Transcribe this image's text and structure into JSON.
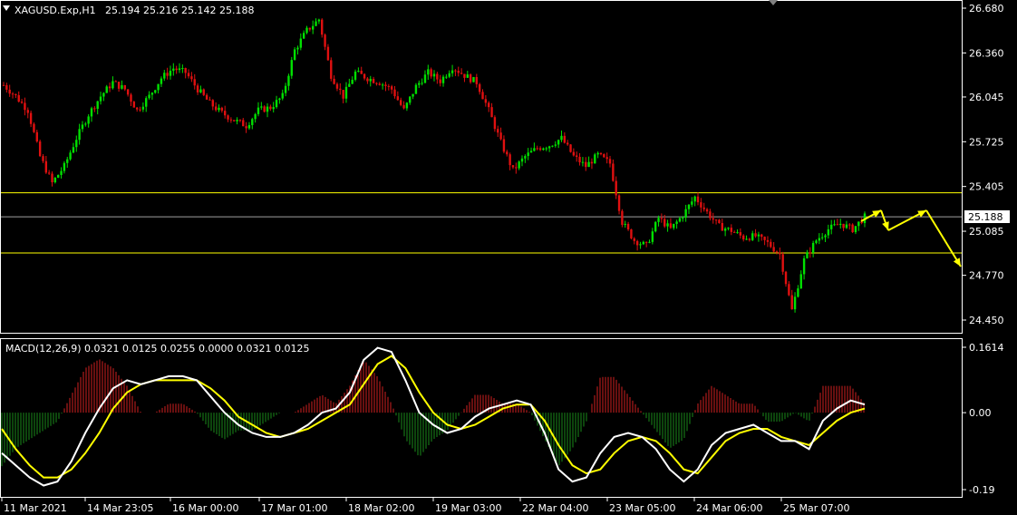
{
  "header": {
    "symbol_label": "XAGUSD.Exp,H1",
    "ohlc_label": "25.194 25.216 25.142 25.188"
  },
  "macd_header": {
    "label": "MACD(12,26,9) 0.0321 0.0125 0.0255 0.0000 0.0321 0.0125"
  },
  "colors": {
    "background": "#000000",
    "bull_candle": "#00e000",
    "bear_candle": "#e01010",
    "level_line": "#ffff00",
    "arrow": "#ffff00",
    "macd_line": "#ffffff",
    "signal_line": "#ffff00",
    "hist_positive": "#d02020",
    "hist_negative": "#1a8a1a",
    "axis": "#ffffff",
    "current_price_box": "#ffffff"
  },
  "price_axis": {
    "ticks": [
      26.68,
      26.36,
      26.045,
      25.725,
      25.405,
      25.085,
      24.77,
      24.45
    ],
    "tick_labels": [
      "26.680",
      "26.360",
      "26.045",
      "25.725",
      "25.405",
      "25.085",
      "24.770",
      "24.450"
    ],
    "current_price": 25.188,
    "current_price_label": "25.188"
  },
  "macd_axis": {
    "ticks": [
      0.1614,
      0.0,
      -0.19
    ],
    "tick_labels": [
      "0.1614",
      "0.00",
      "-0.19"
    ]
  },
  "time_axis": {
    "labels": [
      "11 Mar 2021",
      "14 Mar 23:05",
      "16 Mar 00:00",
      "17 Mar 01:00",
      "18 Mar 02:00",
      "19 Mar 03:00",
      "22 Mar 04:00",
      "23 Mar 05:00",
      "24 Mar 06:00",
      "25 Mar 07:00"
    ]
  },
  "horizontal_levels": [
    25.36,
    25.188,
    24.93
  ],
  "chart_data": {
    "type": "candlestick",
    "symbol": "XAGUSD.Exp",
    "timeframe": "H1",
    "last_ohlc": {
      "open": 25.194,
      "high": 25.216,
      "low": 25.142,
      "close": 25.188
    },
    "price_path": [
      [
        0,
        26.13
      ],
      [
        4,
        26.05
      ],
      [
        8,
        25.95
      ],
      [
        12,
        25.62
      ],
      [
        16,
        25.43
      ],
      [
        20,
        25.55
      ],
      [
        24,
        25.75
      ],
      [
        28,
        25.92
      ],
      [
        32,
        26.05
      ],
      [
        36,
        26.15
      ],
      [
        40,
        26.1
      ],
      [
        44,
        25.95
      ],
      [
        48,
        26.05
      ],
      [
        52,
        26.18
      ],
      [
        56,
        26.25
      ],
      [
        60,
        26.22
      ],
      [
        64,
        26.1
      ],
      [
        68,
        26.0
      ],
      [
        72,
        25.93
      ],
      [
        76,
        25.88
      ],
      [
        80,
        25.84
      ],
      [
        84,
        25.95
      ],
      [
        88,
        25.97
      ],
      [
        92,
        26.05
      ],
      [
        96,
        26.38
      ],
      [
        100,
        26.52
      ],
      [
        104,
        26.6
      ],
      [
        108,
        26.2
      ],
      [
        112,
        26.05
      ],
      [
        116,
        26.22
      ],
      [
        120,
        26.18
      ],
      [
        124,
        26.15
      ],
      [
        128,
        26.1
      ],
      [
        132,
        25.95
      ],
      [
        136,
        26.12
      ],
      [
        140,
        26.22
      ],
      [
        144,
        26.16
      ],
      [
        148,
        26.26
      ],
      [
        152,
        26.2
      ],
      [
        156,
        26.15
      ],
      [
        160,
        25.95
      ],
      [
        164,
        25.72
      ],
      [
        168,
        25.52
      ],
      [
        172,
        25.62
      ],
      [
        176,
        25.68
      ],
      [
        180,
        25.7
      ],
      [
        184,
        25.75
      ],
      [
        188,
        25.62
      ],
      [
        192,
        25.55
      ],
      [
        196,
        25.63
      ],
      [
        200,
        25.57
      ],
      [
        204,
        25.15
      ],
      [
        208,
        25.02
      ],
      [
        212,
        24.98
      ],
      [
        216,
        25.18
      ],
      [
        220,
        25.1
      ],
      [
        224,
        25.2
      ],
      [
        228,
        25.33
      ],
      [
        232,
        25.22
      ],
      [
        236,
        25.12
      ],
      [
        240,
        25.09
      ],
      [
        244,
        25.04
      ],
      [
        248,
        25.05
      ],
      [
        252,
        25.0
      ],
      [
        256,
        24.92
      ],
      [
        260,
        24.52
      ],
      [
        264,
        24.88
      ],
      [
        268,
        25.02
      ],
      [
        272,
        25.1
      ],
      [
        276,
        25.14
      ],
      [
        280,
        25.1
      ],
      [
        284,
        25.188
      ]
    ],
    "projection_arrows": [
      [
        [
          950,
          244
        ],
        [
          972,
          232
        ]
      ],
      [
        [
          972,
          232
        ],
        [
          980,
          254
        ]
      ],
      [
        [
          980,
          254
        ],
        [
          1022,
          232
        ]
      ],
      [
        [
          1022,
          232
        ],
        [
          1060,
          294
        ]
      ]
    ],
    "macd_series": {
      "macd_y": [
        -0.1,
        -0.13,
        -0.16,
        -0.18,
        -0.17,
        -0.12,
        -0.05,
        0.01,
        0.06,
        0.08,
        0.07,
        0.08,
        0.09,
        0.09,
        0.08,
        0.04,
        0.0,
        -0.03,
        -0.05,
        -0.06,
        -0.06,
        -0.05,
        -0.03,
        0.0,
        0.01,
        0.05,
        0.13,
        0.16,
        0.15,
        0.08,
        0.0,
        -0.03,
        -0.05,
        -0.04,
        -0.01,
        0.01,
        0.02,
        0.03,
        0.02,
        -0.05,
        -0.14,
        -0.17,
        -0.16,
        -0.1,
        -0.06,
        -0.05,
        -0.06,
        -0.09,
        -0.14,
        -0.17,
        -0.14,
        -0.08,
        -0.05,
        -0.04,
        -0.03,
        -0.05,
        -0.07,
        -0.07,
        -0.09,
        -0.02,
        0.01,
        0.03,
        0.02
      ],
      "signal_y": [
        -0.04,
        -0.09,
        -0.13,
        -0.16,
        -0.16,
        -0.14,
        -0.1,
        -0.05,
        0.01,
        0.05,
        0.07,
        0.08,
        0.08,
        0.08,
        0.08,
        0.06,
        0.03,
        -0.01,
        -0.03,
        -0.05,
        -0.06,
        -0.05,
        -0.04,
        -0.02,
        0.0,
        0.02,
        0.07,
        0.12,
        0.14,
        0.11,
        0.05,
        0.0,
        -0.03,
        -0.04,
        -0.03,
        -0.01,
        0.01,
        0.02,
        0.02,
        -0.02,
        -0.08,
        -0.13,
        -0.15,
        -0.14,
        -0.1,
        -0.07,
        -0.06,
        -0.07,
        -0.1,
        -0.14,
        -0.15,
        -0.11,
        -0.07,
        -0.05,
        -0.04,
        -0.04,
        -0.06,
        -0.07,
        -0.08,
        -0.05,
        -0.02,
        0.0,
        0.01
      ]
    }
  }
}
